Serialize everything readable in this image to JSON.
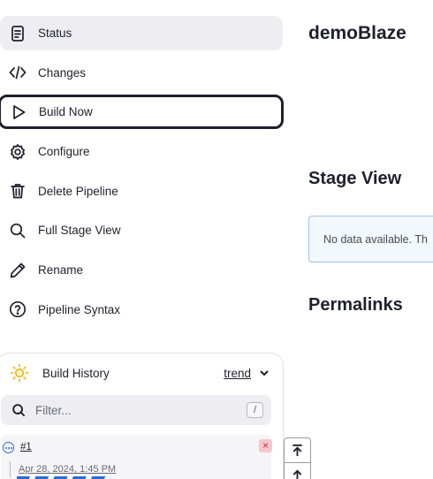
{
  "sidebar": {
    "items": [
      {
        "label": "Status",
        "icon": "document-icon"
      },
      {
        "label": "Changes",
        "icon": "code-icon"
      },
      {
        "label": "Build Now",
        "icon": "play-icon"
      },
      {
        "label": "Configure",
        "icon": "gear-icon"
      },
      {
        "label": "Delete Pipeline",
        "icon": "trash-icon"
      },
      {
        "label": "Full Stage View",
        "icon": "search-icon"
      },
      {
        "label": "Rename",
        "icon": "pencil-icon"
      },
      {
        "label": "Pipeline Syntax",
        "icon": "help-circle-icon"
      }
    ]
  },
  "main": {
    "job_title": "demoBlaze",
    "stage_view_title": "Stage View",
    "stage_view_message": "No data available. Th",
    "permalinks_title": "Permalinks"
  },
  "build_history": {
    "title": "Build History",
    "trend_label": "trend",
    "filter_placeholder": "Filter...",
    "filter_shortcut": "/",
    "builds": [
      {
        "number": "#1",
        "time": "Apr 28, 2024, 1:45 PM",
        "status": "in-progress",
        "cancel_label": "×"
      }
    ]
  },
  "colors": {
    "accent": "#2b6bd1",
    "active_bg": "#eeeef2",
    "danger": "#d02c3a"
  }
}
